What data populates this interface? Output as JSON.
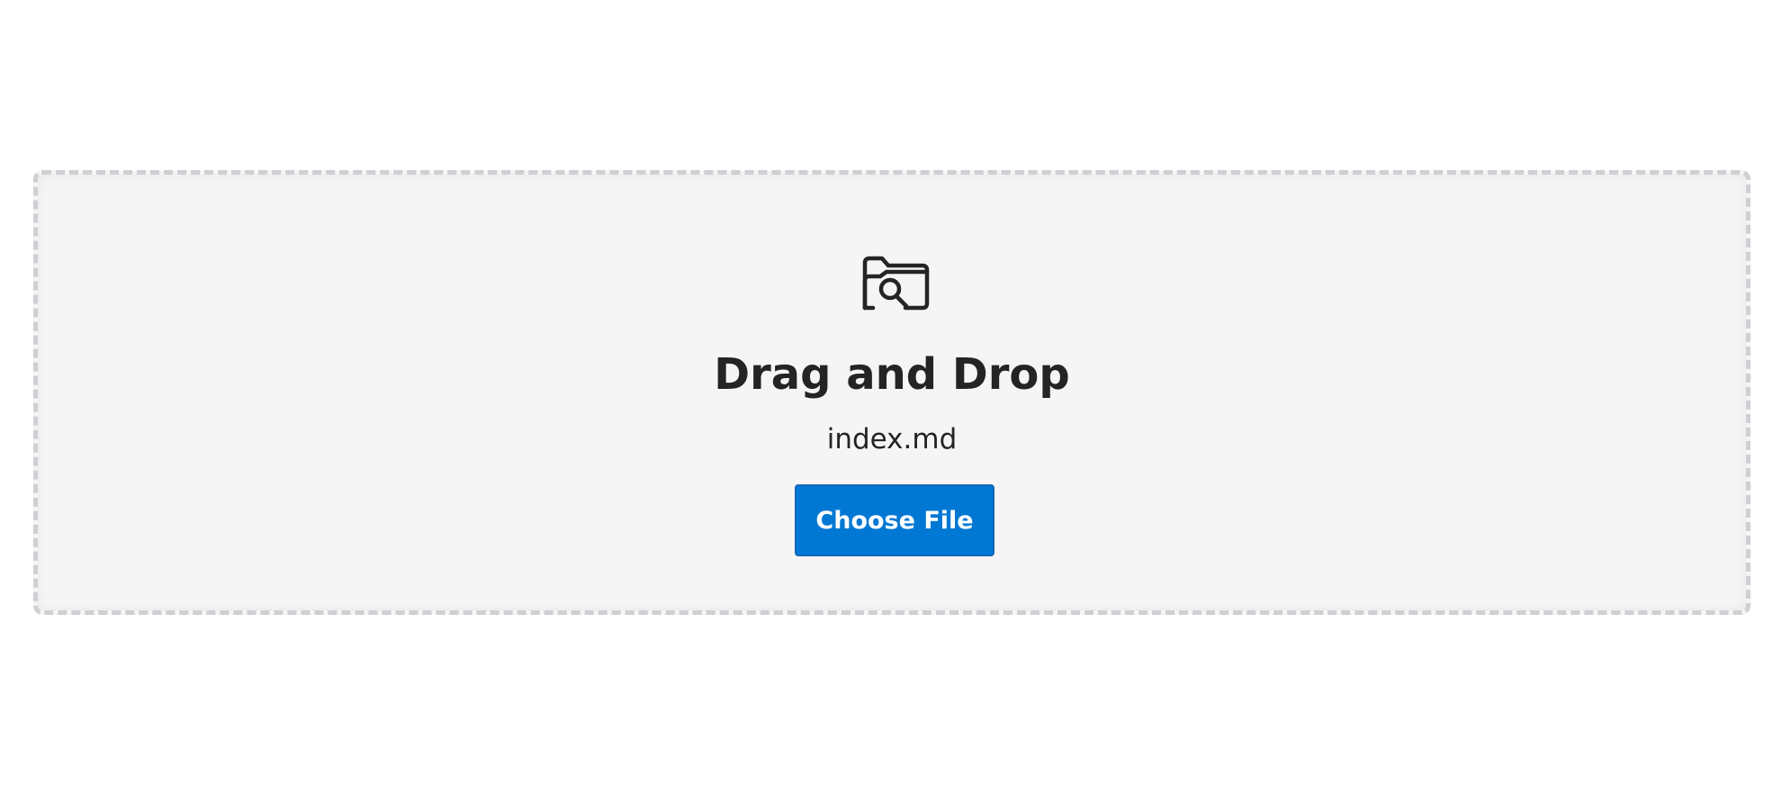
{
  "dropzone": {
    "icon": "folder-search-icon",
    "title": "Drag and Drop",
    "filename": "index.md",
    "button_label": "Choose File"
  },
  "colors": {
    "accent": "#0078d4",
    "background": "#f5f5f5",
    "border": "#cfcfd4",
    "text": "#242424"
  }
}
